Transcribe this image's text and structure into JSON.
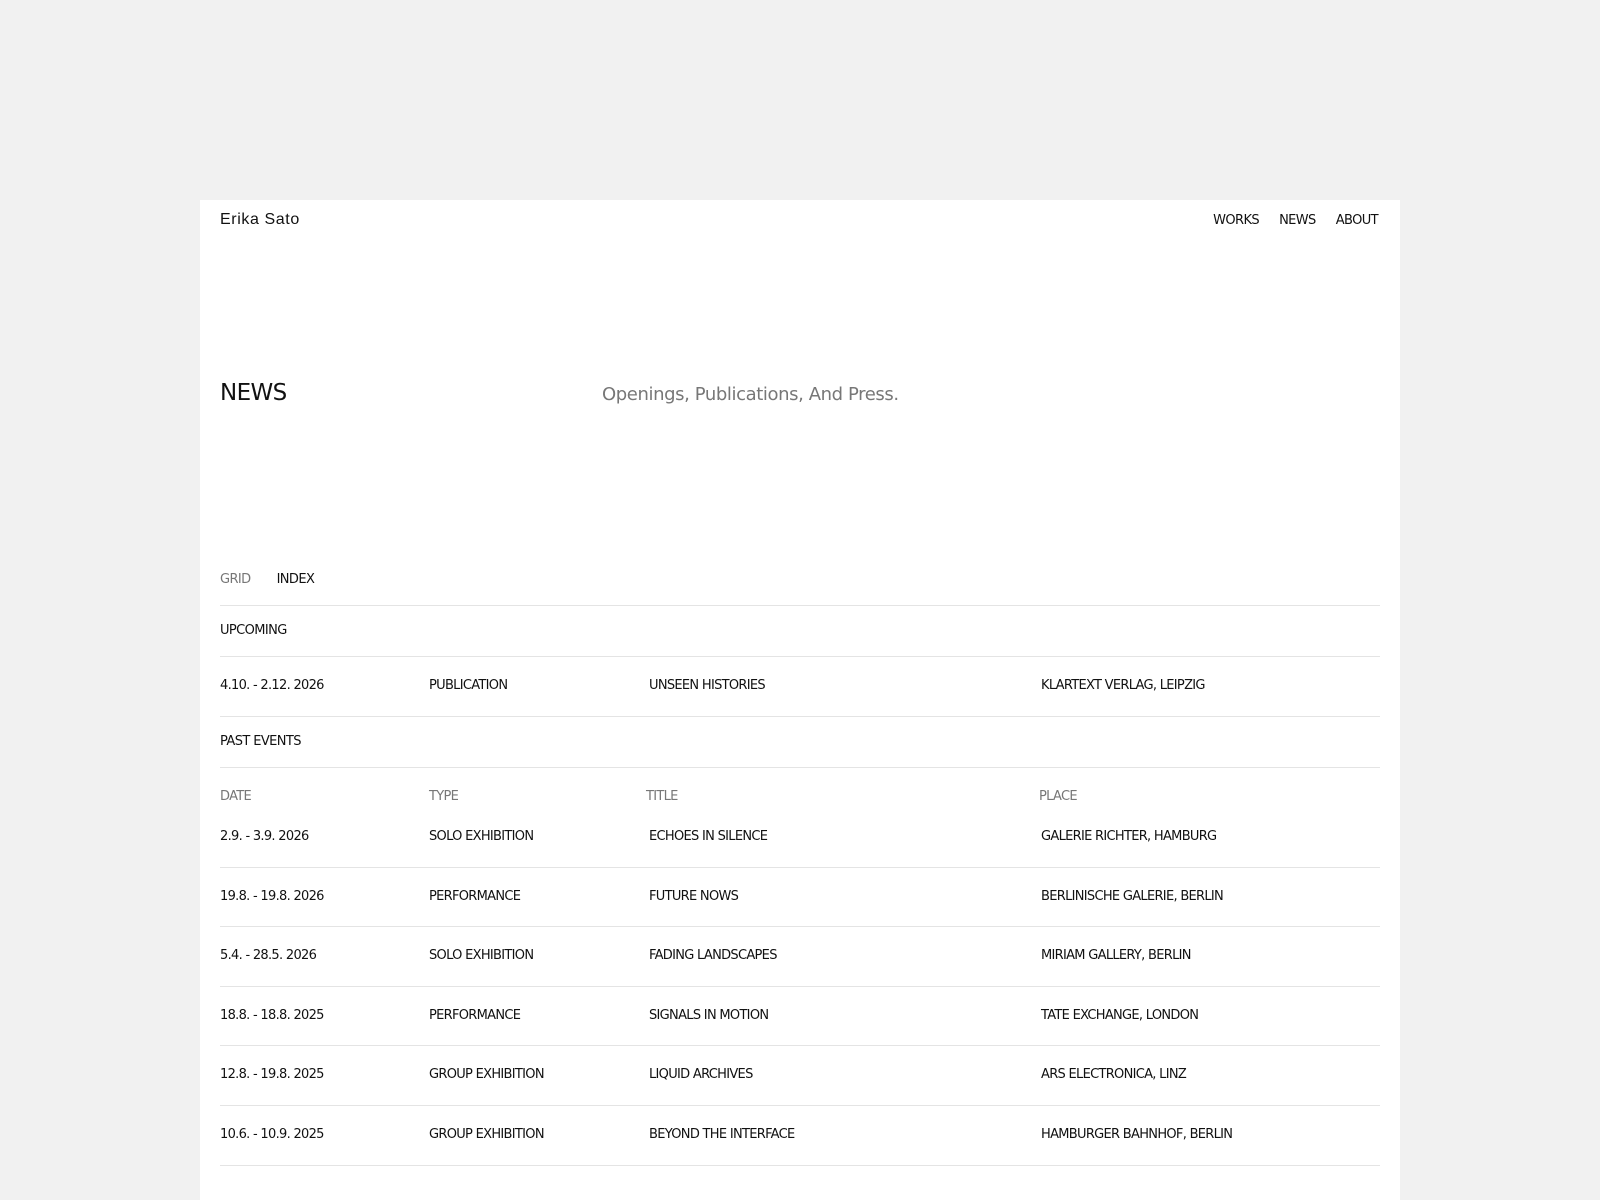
{
  "header": {
    "site_name": "Erika Sato",
    "nav": [
      "WORKS",
      "NEWS",
      "ABOUT"
    ]
  },
  "page": {
    "title": "NEWS",
    "intro": "Openings, Publications, And Press."
  },
  "view_toggle": {
    "options": [
      "GRID",
      "INDEX"
    ],
    "selected": "INDEX"
  },
  "upcoming": {
    "label": "UPCOMING",
    "rows": [
      {
        "date": "4.10. - 2.12. 2026",
        "type": "PUBLICATION",
        "title": "UNSEEN HISTORIES",
        "place": "KLARTEXT VERLAG, LEIPZIG"
      }
    ]
  },
  "past": {
    "label": "PAST EVENTS",
    "columns": [
      "DATE",
      "TYPE",
      "TITLE",
      "PLACE"
    ],
    "rows": [
      {
        "date": "2.9. - 3.9. 2026",
        "type": "SOLO EXHIBITION",
        "title": "ECHOES IN SILENCE",
        "place": "GALERIE RICHTER, HAMBURG"
      },
      {
        "date": "19.8. - 19.8. 2026",
        "type": "PERFORMANCE",
        "title": "FUTURE NOWS",
        "place": "BERLINISCHE GALERIE, BERLIN"
      },
      {
        "date": "5.4. - 28.5. 2026",
        "type": "SOLO EXHIBITION",
        "title": "FADING LANDSCAPES",
        "place": "MIRIAM GALLERY, BERLIN"
      },
      {
        "date": "18.8. - 18.8. 2025",
        "type": "PERFORMANCE",
        "title": "SIGNALS IN MOTION",
        "place": "TATE EXCHANGE, LONDON"
      },
      {
        "date": "12.8. - 19.8. 2025",
        "type": "GROUP EXHIBITION",
        "title": "LIQUID ARCHIVES",
        "place": "ARS ELECTRONICA, LINZ"
      },
      {
        "date": "10.6. - 10.9. 2025",
        "type": "GROUP EXHIBITION",
        "title": "BEYOND THE INTERFACE",
        "place": "HAMBURGER BAHNHOF, BERLIN"
      }
    ]
  },
  "colors": {
    "background": "#f1f1f1",
    "panel": "#ffffff",
    "text": "#111111",
    "muted": "#777777",
    "divider": "#e4e4e4"
  }
}
